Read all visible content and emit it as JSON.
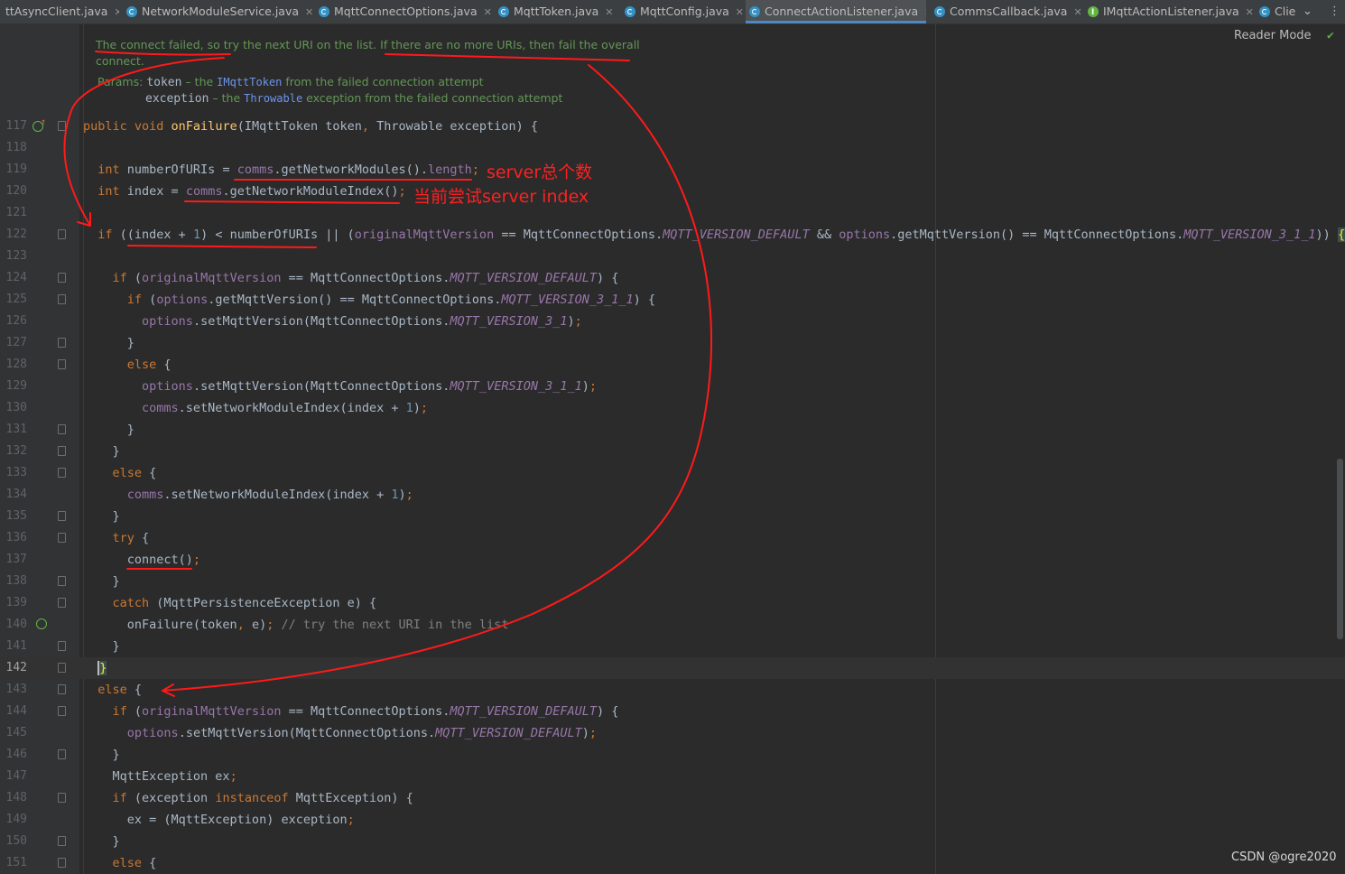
{
  "tabs": [
    {
      "label": "ttAsyncClient.java",
      "icon": "class-icon",
      "active": false
    },
    {
      "label": "NetworkModuleService.java",
      "icon": "class-icon",
      "active": false
    },
    {
      "label": "MqttConnectOptions.java",
      "icon": "class-icon",
      "active": false
    },
    {
      "label": "MqttToken.java",
      "icon": "class-icon",
      "active": false
    },
    {
      "label": "MqttConfig.java",
      "icon": "class-icon",
      "active": false
    },
    {
      "label": "ConnectActionListener.java",
      "icon": "class-icon",
      "active": true
    },
    {
      "label": "CommsCallback.java",
      "icon": "class-icon",
      "active": false
    },
    {
      "label": "IMqttActionListener.java",
      "icon": "interface-icon",
      "active": false
    },
    {
      "label": "Clie",
      "icon": "class-icon",
      "active": false
    }
  ],
  "toolbar": {
    "reader_mode": "Reader Mode"
  },
  "javadoc": {
    "line1": "The connect failed, so try the next URI on the list. If there are no more URIs, then fail the overall",
    "line2": "connect.",
    "params_label": "Params:",
    "param1_name": "token",
    "param1_pre": " – the ",
    "param1_type": "IMqttToken",
    "param1_post": " from the failed connection attempt",
    "param2_name": "exception",
    "param2_pre": " – the ",
    "param2_type": "Throwable",
    "param2_post": " exception from the failed connection attempt"
  },
  "code_lines": [
    {
      "n": 117,
      "html": "<span class='kw'>public void </span><span class='fn'>onFailure</span>(IMqttToken token<span class='kw'>, </span>Throwable exception) {"
    },
    {
      "n": 118,
      "html": ""
    },
    {
      "n": 119,
      "html": "  <span class='kw'>int </span>numberOfURIs = <span class='fld'>comms</span>.getNetworkModules().<span class='fld'>length</span><span class='kw'>;</span>"
    },
    {
      "n": 120,
      "html": "  <span class='kw'>int </span>index = <span class='fld'>comms</span>.getNetworkModuleIndex()<span class='kw'>;</span>"
    },
    {
      "n": 121,
      "html": ""
    },
    {
      "n": 122,
      "html": "  <span class='kw'>if </span>((index + <span class='num'>1</span>) &lt; numberOfURIs || (<span class='fld'>originalMqttVersion</span> == MqttConnectOptions.<span class='cst'>MQTT_VERSION_DEFAULT</span> &amp;&amp; <span class='fld'>options</span>.getMqttVersion() == MqttConnectOptions.<span class='cst'>MQTT_VERSION_3_1_1</span>)) <span class='brk'>{</span>"
    },
    {
      "n": 123,
      "html": ""
    },
    {
      "n": 124,
      "html": "    <span class='kw'>if </span>(<span class='fld'>originalMqttVersion</span> == MqttConnectOptions.<span class='cst'>MQTT_VERSION_DEFAULT</span>) {"
    },
    {
      "n": 125,
      "html": "      <span class='kw'>if </span>(<span class='fld'>options</span>.getMqttVersion() == MqttConnectOptions.<span class='cst'>MQTT_VERSION_3_1_1</span>) {"
    },
    {
      "n": 126,
      "html": "        <span class='fld'>options</span>.setMqttVersion(MqttConnectOptions.<span class='cst'>MQTT_VERSION_3_1</span>)<span class='kw'>;</span>"
    },
    {
      "n": 127,
      "html": "      }"
    },
    {
      "n": 128,
      "html": "      <span class='kw'>else </span>{"
    },
    {
      "n": 129,
      "html": "        <span class='fld'>options</span>.setMqttVersion(MqttConnectOptions.<span class='cst'>MQTT_VERSION_3_1_1</span>)<span class='kw'>;</span>"
    },
    {
      "n": 130,
      "html": "        <span class='fld'>comms</span>.setNetworkModuleIndex(index + <span class='num'>1</span>)<span class='kw'>;</span>"
    },
    {
      "n": 131,
      "html": "      }"
    },
    {
      "n": 132,
      "html": "    }"
    },
    {
      "n": 133,
      "html": "    <span class='kw'>else </span>{"
    },
    {
      "n": 134,
      "html": "      <span class='fld'>comms</span>.setNetworkModuleIndex(index + <span class='num'>1</span>)<span class='kw'>;</span>"
    },
    {
      "n": 135,
      "html": "    }"
    },
    {
      "n": 136,
      "html": "    <span class='kw'>try </span>{"
    },
    {
      "n": 137,
      "html": "      connect()<span class='kw'>;</span>"
    },
    {
      "n": 138,
      "html": "    }"
    },
    {
      "n": 139,
      "html": "    <span class='kw'>catch </span>(MqttPersistenceException e) {"
    },
    {
      "n": 140,
      "html": "      onFailure(token<span class='kw'>, </span>e)<span class='kw'>; </span><span class='cmt'>// try the next URI in the list</span>"
    },
    {
      "n": 141,
      "html": "    }"
    },
    {
      "n": 142,
      "html": "  <span class='brk caret'>}</span>"
    },
    {
      "n": 143,
      "html": "  <span class='kw'>else </span>{"
    },
    {
      "n": 144,
      "html": "    <span class='kw'>if </span>(<span class='fld'>originalMqttVersion</span> == MqttConnectOptions.<span class='cst'>MQTT_VERSION_DEFAULT</span>) {"
    },
    {
      "n": 145,
      "html": "      <span class='fld'>options</span>.setMqttVersion(MqttConnectOptions.<span class='cst'>MQTT_VERSION_DEFAULT</span>)<span class='kw'>;</span>"
    },
    {
      "n": 146,
      "html": "    }"
    },
    {
      "n": 147,
      "html": "    MqttException ex<span class='kw'>;</span>"
    },
    {
      "n": 148,
      "html": "    <span class='kw'>if </span>(exception <span class='kw'>instanceof </span>MqttException) {"
    },
    {
      "n": 149,
      "html": "      ex = (MqttException) exception<span class='kw'>;</span>"
    },
    {
      "n": 150,
      "html": "    }"
    },
    {
      "n": 151,
      "html": "    <span class='kw'>else </span>{"
    }
  ],
  "current_line": 142,
  "annotations": {
    "total_servers": "server总个数",
    "current_index": "当前尝试server index"
  },
  "watermark": "CSDN @ogre2020",
  "colors": {
    "annotation_ink": "#ff1a1a",
    "keyword": "#cc7832",
    "method": "#ffc66d",
    "field": "#9876aa",
    "number": "#6897bb",
    "doc": "#629755",
    "background": "#2b2b2b"
  }
}
